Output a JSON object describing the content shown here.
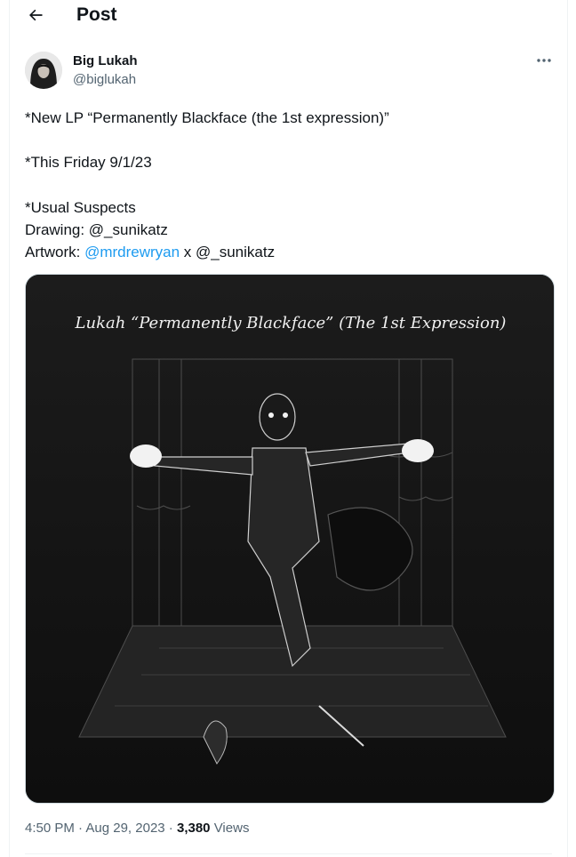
{
  "header": {
    "title": "Post",
    "back_icon": "arrow-left-icon"
  },
  "author": {
    "display_name": "Big Lukah",
    "handle": "@biglukah",
    "more_icon": "more-horizontal-icon"
  },
  "post": {
    "line1": "*New LP “Permanently Blackface (the 1st expression)”",
    "line2": "*This Friday 9/1/23",
    "line3": "*Usual Suspects",
    "line4": "Drawing: @_sunikatz",
    "line5_prefix": "Artwork: ",
    "line5_link": "@mrdrewryan",
    "line5_suffix": " x @_sunikatz"
  },
  "media": {
    "handwritten_title": "Lukah “Permanently Blackface” (The 1st Expression)"
  },
  "meta": {
    "time": "4:50 PM",
    "separator": " · ",
    "date": "Aug 29, 2023",
    "views_count": "3,380",
    "views_label": " Views"
  },
  "colors": {
    "link": "#1d9bf0",
    "secondary_text": "#536471",
    "text": "#0f1419"
  }
}
